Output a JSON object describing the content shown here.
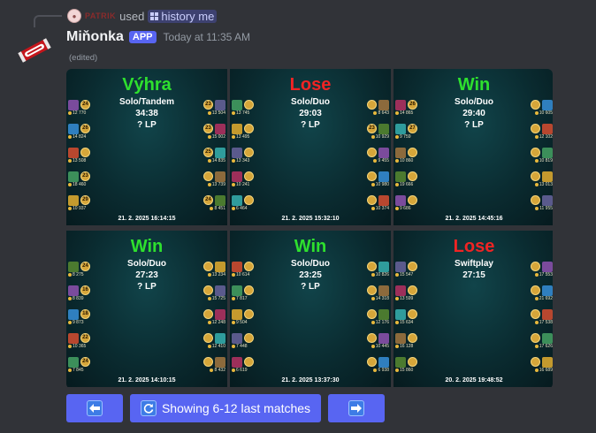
{
  "reply": {
    "user": "PATRIK",
    "verb": "used",
    "command": "history me",
    "avatar_icon": "user-avatar-icon",
    "command_icon": "slash-command-grid-icon"
  },
  "message": {
    "username": "Miňonka",
    "badge": "APP",
    "timestamp": "Today at 11:35 AM",
    "edited": "(edited)",
    "avatar_icon": "candy-bar-icon"
  },
  "colors": {
    "win": "#2ee02e",
    "lose": "#f02424",
    "button": "#5865f2",
    "background": "#313338"
  },
  "matches": [
    {
      "result": "Výhra",
      "outcome": "win",
      "queue": "Solo/Tandem",
      "duration": "34:38",
      "lp": "? LP",
      "date": "21. 2. 2025 16:14:15",
      "left": [
        {
          "level": "24",
          "gold": "12 770"
        },
        {
          "level": "26",
          "gold": "14 824"
        },
        {
          "level": "",
          "gold": "13 508"
        },
        {
          "level": "23",
          "gold": "18 460"
        },
        {
          "level": "29",
          "gold": "10 937"
        }
      ],
      "right": [
        {
          "level": "23",
          "gold": "13 504"
        },
        {
          "level": "23",
          "gold": "15 002"
        },
        {
          "level": "25",
          "gold": "14 835"
        },
        {
          "level": "",
          "gold": "13 739"
        },
        {
          "level": "24",
          "gold": "8 451"
        }
      ]
    },
    {
      "result": "Lose",
      "outcome": "lose",
      "queue": "Solo/Duo",
      "duration": "29:03",
      "lp": "? LP",
      "date": "21. 2. 2025 15:32:10",
      "left": [
        {
          "level": "",
          "gold": "13 745"
        },
        {
          "level": "",
          "gold": "13 495"
        },
        {
          "level": "",
          "gold": "13 343"
        },
        {
          "level": "",
          "gold": "10 241"
        },
        {
          "level": "",
          "gold": "6 464"
        }
      ],
      "right": [
        {
          "level": "",
          "gold": "8 643"
        },
        {
          "level": "23",
          "gold": "10 929"
        },
        {
          "level": "",
          "gold": "9 455"
        },
        {
          "level": "",
          "gold": "10 980"
        },
        {
          "level": "",
          "gold": "10 374"
        }
      ]
    },
    {
      "result": "Win",
      "outcome": "win",
      "queue": "Solo/Duo",
      "duration": "29:40",
      "lp": "? LP",
      "date": "21. 2. 2025 14:45:16",
      "left": [
        {
          "level": "26",
          "gold": "14 865"
        },
        {
          "level": "27",
          "gold": "9 759"
        },
        {
          "level": "",
          "gold": "10 860"
        },
        {
          "level": "",
          "gold": "19 666"
        },
        {
          "level": "",
          "gold": "9 686"
        }
      ],
      "right": [
        {
          "level": "",
          "gold": "10 605"
        },
        {
          "level": "",
          "gold": "12 102"
        },
        {
          "level": "",
          "gold": "10 819"
        },
        {
          "level": "",
          "gold": "13 013"
        },
        {
          "level": "",
          "gold": "11 955"
        }
      ]
    },
    {
      "result": "Win",
      "outcome": "win",
      "queue": "Solo/Duo",
      "duration": "27:23",
      "lp": "? LP",
      "date": "21. 2. 2025 14:10:15",
      "left": [
        {
          "level": "24",
          "gold": "8 275"
        },
        {
          "level": "16",
          "gold": "8 839"
        },
        {
          "level": "18",
          "gold": "9 873"
        },
        {
          "level": "22",
          "gold": "10 365"
        },
        {
          "level": "24",
          "gold": "7 845"
        }
      ],
      "right": [
        {
          "level": "",
          "gold": "13 234"
        },
        {
          "level": "",
          "gold": "15 725"
        },
        {
          "level": "",
          "gold": "12 248"
        },
        {
          "level": "",
          "gold": "12 410"
        },
        {
          "level": "",
          "gold": "8 432"
        }
      ]
    },
    {
      "result": "Win",
      "outcome": "win",
      "queue": "Solo/Duo",
      "duration": "23:25",
      "lp": "? LP",
      "date": "21. 2. 2025 13:37:30",
      "left": [
        {
          "level": "",
          "gold": "10 614"
        },
        {
          "level": "",
          "gold": "7 817"
        },
        {
          "level": "",
          "gold": "9 504"
        },
        {
          "level": "",
          "gold": "7 448"
        },
        {
          "level": "",
          "gold": "6 619"
        }
      ],
      "right": [
        {
          "level": "",
          "gold": "10 826"
        },
        {
          "level": "",
          "gold": "14 318"
        },
        {
          "level": "",
          "gold": "12 176"
        },
        {
          "level": "",
          "gold": "10 445"
        },
        {
          "level": "",
          "gold": "6 938"
        }
      ]
    },
    {
      "result": "Lose",
      "outcome": "lose",
      "queue": "Swiftplay",
      "duration": "27:15",
      "lp": "",
      "date": "20. 2. 2025 19:48:52",
      "left": [
        {
          "level": "",
          "gold": "15 547"
        },
        {
          "level": "",
          "gold": "13 599"
        },
        {
          "level": "",
          "gold": "15 634"
        },
        {
          "level": "",
          "gold": "16 128"
        },
        {
          "level": "",
          "gold": "15 860"
        }
      ],
      "right": [
        {
          "level": "",
          "gold": "17 553"
        },
        {
          "level": "",
          "gold": "21 692"
        },
        {
          "level": "",
          "gold": "17 538"
        },
        {
          "level": "",
          "gold": "17 626"
        },
        {
          "level": "",
          "gold": "16 689"
        }
      ]
    }
  ],
  "buttons": {
    "prev_icon": "arrow-left-icon",
    "refresh_icon": "refresh-icon",
    "refresh_label": "Showing 6-12 last matches",
    "next_icon": "arrow-right-icon"
  }
}
